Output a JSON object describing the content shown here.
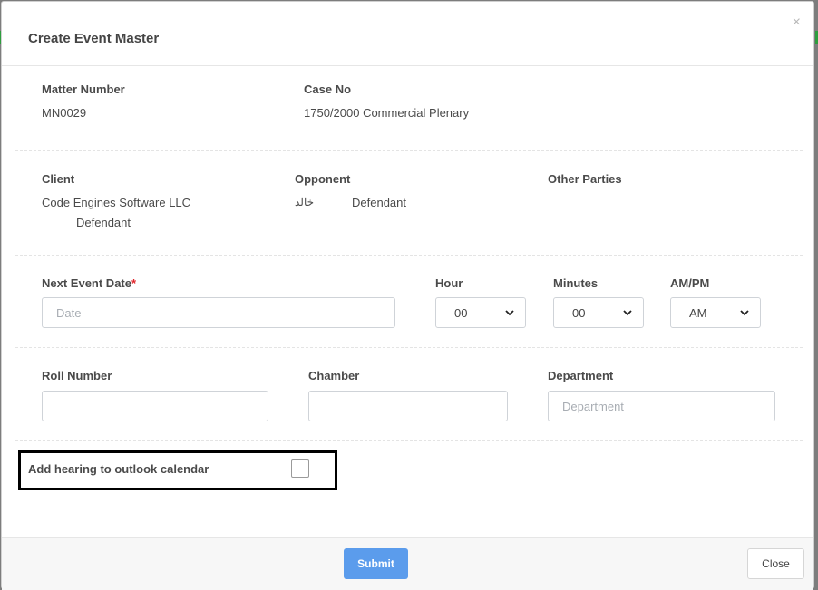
{
  "modal": {
    "title": "Create Event Master",
    "close_glyph": "×"
  },
  "matter": {
    "matter_number_label": "Matter Number",
    "matter_number_value": "MN0029",
    "case_no_label": "Case No",
    "case_no_value": "1750/2000 Commercial Plenary"
  },
  "parties": {
    "client_label": "Client",
    "client_name": "Code Engines Software LLC",
    "client_role": "Defendant",
    "opponent_label": "Opponent",
    "opponent_name": "خالد",
    "opponent_role": "Defendant",
    "other_parties_label": "Other Parties"
  },
  "event": {
    "next_event_date_label": "Next Event Date",
    "required_mark": "*",
    "date_placeholder": "Date",
    "hour_label": "Hour",
    "hour_value": "00",
    "minutes_label": "Minutes",
    "minutes_value": "00",
    "ampm_label": "AM/PM",
    "ampm_value": "AM"
  },
  "details": {
    "roll_number_label": "Roll Number",
    "roll_number_value": "",
    "chamber_label": "Chamber",
    "chamber_value": "",
    "department_label": "Department",
    "department_placeholder": "Department"
  },
  "outlook": {
    "label": "Add hearing to outlook calendar",
    "checked": false
  },
  "footer": {
    "submit_label": "Submit",
    "close_label": "Close"
  },
  "colors": {
    "accent": "#5b9cec",
    "required": "#e0252b",
    "highlight_border": "#000000"
  },
  "icons": {
    "close": "close-icon",
    "select_caret": "chevron-down-icon"
  }
}
